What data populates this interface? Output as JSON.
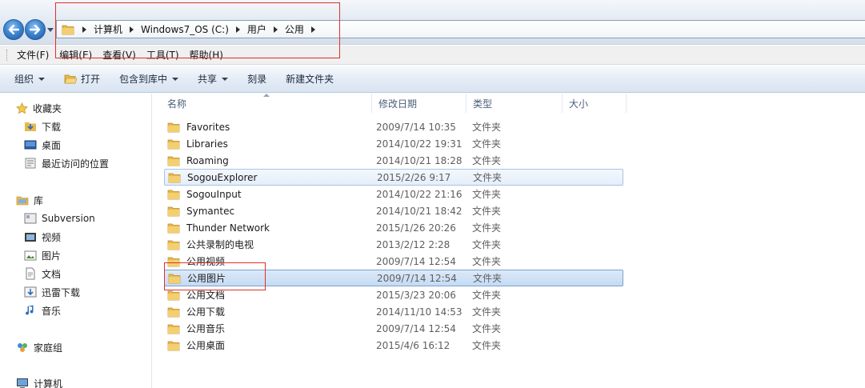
{
  "address_bar": {
    "breadcrumbs": [
      "计算机",
      "Windows7_OS (C:)",
      "用户",
      "公用"
    ]
  },
  "menu": {
    "items": [
      "文件(F)",
      "编辑(E)",
      "查看(V)",
      "工具(T)",
      "帮助(H)"
    ]
  },
  "toolbar": {
    "organize": "组织",
    "open": "打开",
    "include_in_library": "包含到库中",
    "share": "共享",
    "burn": "刻录",
    "new_folder": "新建文件夹"
  },
  "nav": {
    "favorites": {
      "label": "收藏夹",
      "items": [
        "下载",
        "桌面",
        "最近访问的位置"
      ]
    },
    "libraries": {
      "label": "库",
      "items": [
        "Subversion",
        "视频",
        "图片",
        "文档",
        "迅雷下载",
        "音乐"
      ]
    },
    "homegroup": "家庭组",
    "computer": "计算机"
  },
  "columns": {
    "name": "名称",
    "date_modified": "修改日期",
    "type": "类型",
    "size": "大小"
  },
  "files": [
    {
      "name": "Favorites",
      "date": "2009/7/14 10:35",
      "type": "文件夹"
    },
    {
      "name": "Libraries",
      "date": "2014/10/22 19:31",
      "type": "文件夹"
    },
    {
      "name": "Roaming",
      "date": "2014/10/21 18:28",
      "type": "文件夹"
    },
    {
      "name": "SogouExplorer",
      "date": "2015/2/26 9:17",
      "type": "文件夹"
    },
    {
      "name": "SogouInput",
      "date": "2014/10/22 21:16",
      "type": "文件夹"
    },
    {
      "name": "Symantec",
      "date": "2014/10/21 18:42",
      "type": "文件夹"
    },
    {
      "name": "Thunder Network",
      "date": "2015/1/26 20:26",
      "type": "文件夹"
    },
    {
      "name": "公共录制的电视",
      "date": "2013/2/12 2:28",
      "type": "文件夹"
    },
    {
      "name": "公用视频",
      "date": "2009/7/14 12:54",
      "type": "文件夹"
    },
    {
      "name": "公用图片",
      "date": "2009/7/14 12:54",
      "type": "文件夹"
    },
    {
      "name": "公用文档",
      "date": "2015/3/23 20:06",
      "type": "文件夹"
    },
    {
      "name": "公用下载",
      "date": "2014/11/10 14:53",
      "type": "文件夹"
    },
    {
      "name": "公用音乐",
      "date": "2009/7/14 12:54",
      "type": "文件夹"
    },
    {
      "name": "公用桌面",
      "date": "2015/4/6 16:12",
      "type": "文件夹"
    }
  ],
  "colors": {
    "folder": "#e8b94a",
    "selection": "#c5dbf4",
    "annotation": "#e0302a"
  },
  "icons": {
    "back": "back-arrow-icon",
    "forward": "forward-arrow-icon",
    "folder": "folder-icon",
    "star": "star-icon",
    "library": "library-icon",
    "homegroup": "homegroup-icon",
    "computer": "computer-icon"
  }
}
